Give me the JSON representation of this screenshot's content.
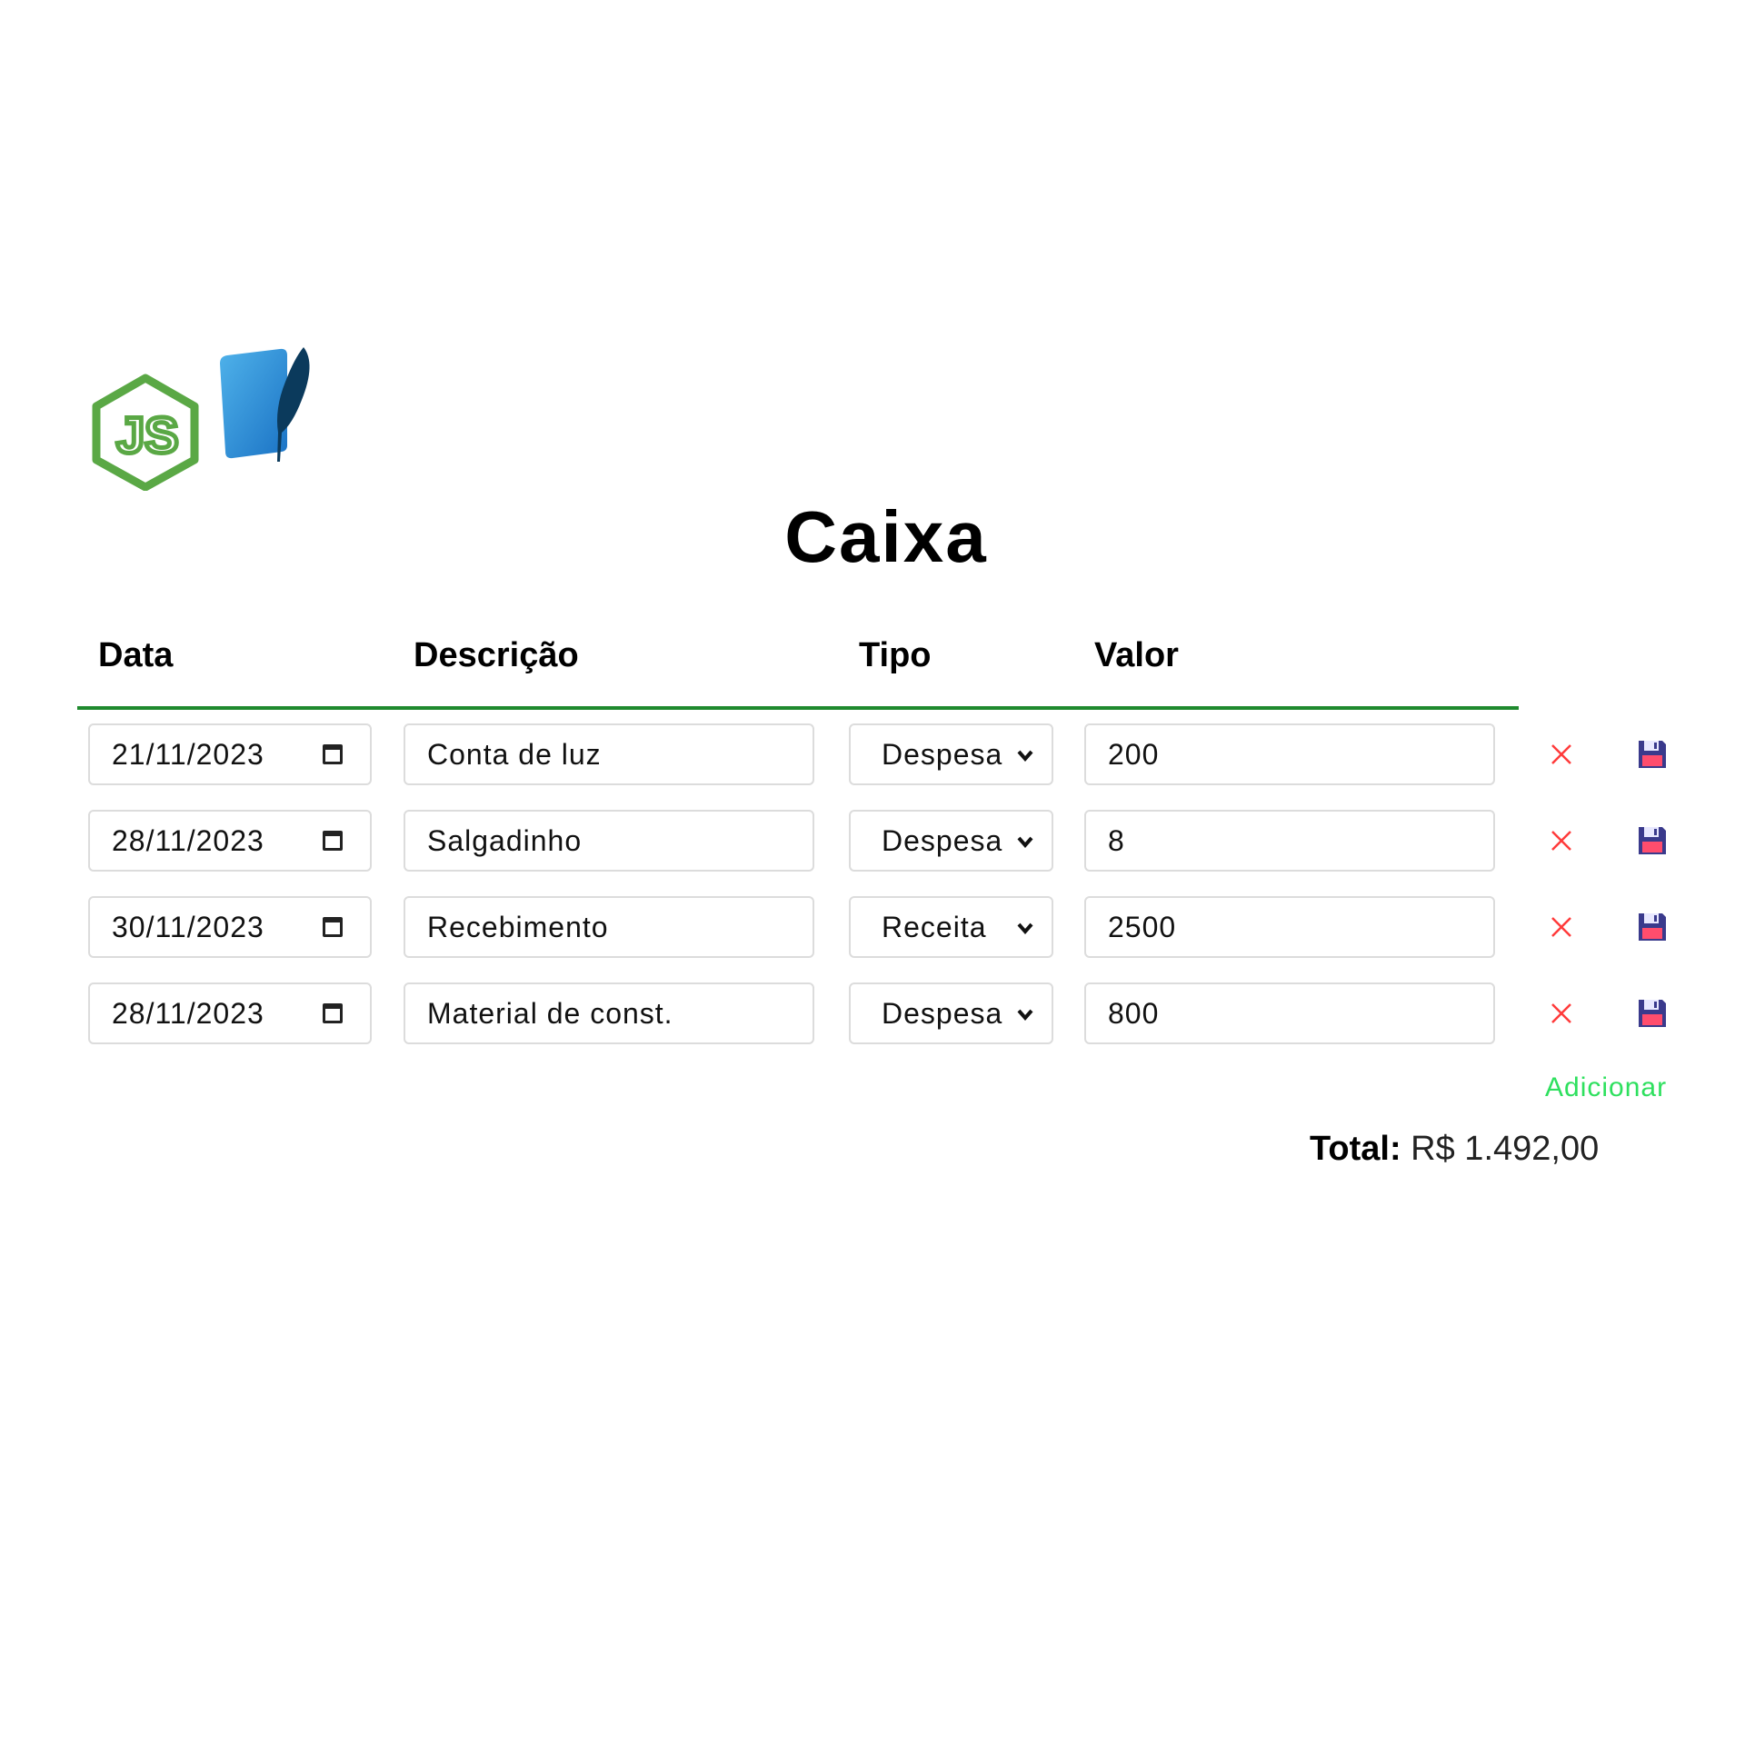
{
  "page": {
    "title": "Caixa"
  },
  "logos": {
    "node": "node-js-logo",
    "sqlite": "sqlite-logo"
  },
  "table": {
    "headers": {
      "date": "Data",
      "description": "Descrição",
      "type": "Tipo",
      "value": "Valor"
    },
    "rows": [
      {
        "date": "21/11/2023",
        "description": "Conta de luz",
        "type": "Despesa",
        "value": "200"
      },
      {
        "date": "28/11/2023",
        "description": "Salgadinho",
        "type": "Despesa",
        "value": "8"
      },
      {
        "date": "30/11/2023",
        "description": "Recebimento",
        "type": "Receita",
        "value": "2500"
      },
      {
        "date": "28/11/2023",
        "description": "Material de const.",
        "type": "Despesa",
        "value": "800"
      }
    ]
  },
  "actions": {
    "add_label": "Adicionar"
  },
  "total": {
    "label": "Total:",
    "value": "R$ 1.492,00"
  },
  "colors": {
    "accent_line": "#1f8a2e",
    "add_link": "#2ee05e",
    "delete": "#ff3b3b",
    "save": "#3a3a8c"
  },
  "icons": {
    "delete": "close-icon",
    "save": "floppy-disk-icon",
    "date": "calendar-icon",
    "select": "chevron-down-icon"
  }
}
